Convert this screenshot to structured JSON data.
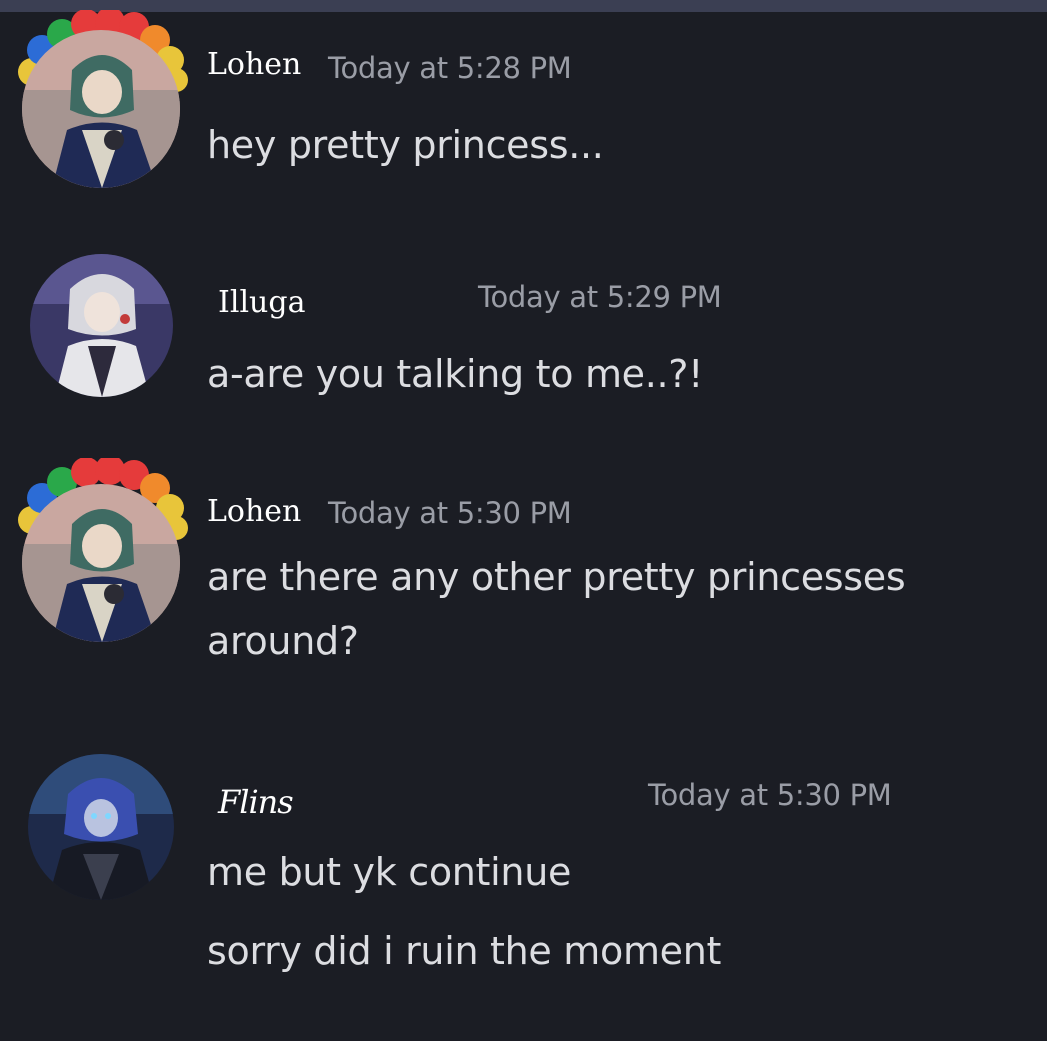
{
  "messages": [
    {
      "author": "Lohen",
      "timestamp": "Today at 5:28 PM",
      "lines": [
        "hey pretty princess..."
      ],
      "avatar": "lohen-avatar-icon"
    },
    {
      "author": "Illuga",
      "timestamp": "Today at 5:29 PM",
      "lines": [
        "a-are you talking to me..?!"
      ],
      "avatar": "illuga-avatar-icon"
    },
    {
      "author": "Lohen",
      "timestamp": "Today at 5:30 PM",
      "lines": [
        "are there any other pretty princesses",
        "around?"
      ],
      "avatar": "lohen-avatar-icon"
    },
    {
      "author": "Flins",
      "timestamp": "Today at 5:30 PM",
      "lines": [
        "me but yk continue",
        "sorry did i ruin the moment"
      ],
      "avatar": "flins-avatar-icon"
    }
  ],
  "colors": {
    "background": "#1b1d24",
    "top_bar": "#3b3f53",
    "author": "#ffffff",
    "timestamp": "#9a9da6",
    "message_text": "#dcdde1"
  }
}
